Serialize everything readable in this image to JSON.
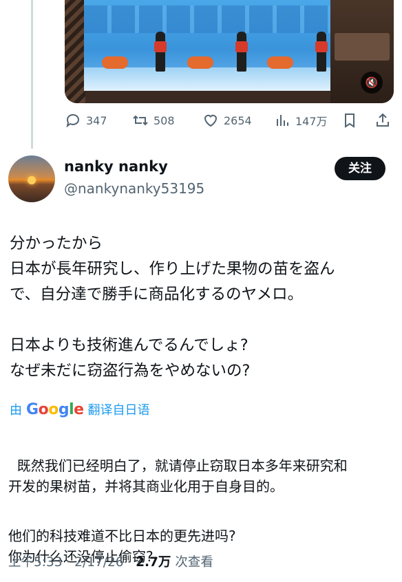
{
  "post_actions": {
    "replies": "347",
    "reposts": "508",
    "likes": "2654",
    "views": "147万"
  },
  "tweet": {
    "display_name": "nanky nanky",
    "handle": "@nankynanky53195",
    "follow_label": "关注",
    "text": "分かったから\n日本が長年研究し、作り上げた果物の苗を盗ん\nで、自分達で勝手に商品化するのヤメロ。\n\n日本よりも技術進んでるんでしょ?\nなぜ未だに窃盗行為をやめないの?",
    "translated_prefix": "由",
    "translated_brand": "Google",
    "translated_suffix": "翻译自日语",
    "translation_p1": "既然我们已经明白了，就请停止窃取日本多年来研究和\n开发的果树苗，并将其商业化用于自身目的。",
    "translation_p2": "他们的科技难道不比日本的更先进吗?\n你为什么还没停止偷窃?",
    "time": "上午5:33 · 2/17/26 · ",
    "view_count": "2.7万",
    "view_suffix": " 次查看"
  },
  "icons": [
    "reply-icon",
    "repost-icon",
    "like-icon",
    "views-icon",
    "bookmark-icon",
    "share-icon",
    "mute-icon"
  ],
  "colors": {
    "link": "#1d9bf0",
    "secondary": "#536471",
    "text": "#0f1419",
    "follow_bg": "#0f1419"
  }
}
